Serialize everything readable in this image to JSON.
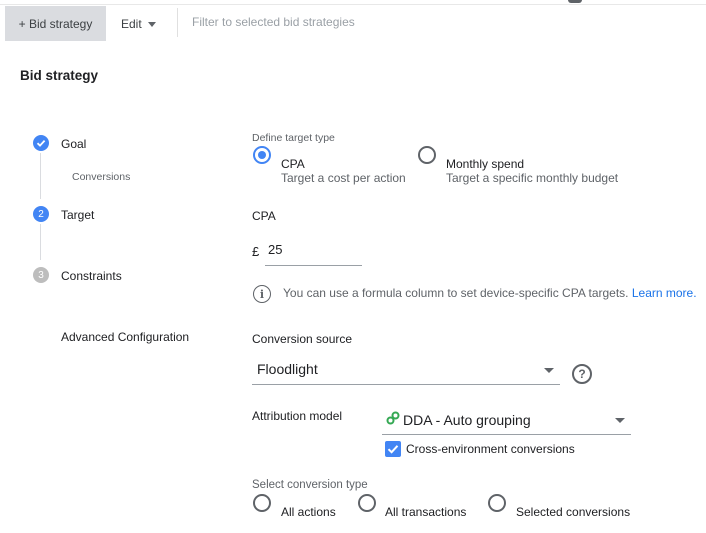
{
  "toolbar": {
    "add_bid_strategy": "+ Bid strategy",
    "edit": "Edit",
    "filter": "Filter to selected bid strategies"
  },
  "section_title": "Bid strategy",
  "steps": [
    {
      "label": "Goal",
      "state": "done",
      "sub": "Conversions"
    },
    {
      "label": "Target",
      "state": "active",
      "number": "2"
    },
    {
      "label": "Constraints",
      "state": "todo",
      "number": "3"
    },
    {
      "label": "Advanced Configuration"
    }
  ],
  "target_type": {
    "label": "Define target type",
    "options": [
      {
        "title": "CPA",
        "desc": "Target a cost per action",
        "selected": true
      },
      {
        "title": "Monthly spend",
        "desc": "Target a specific monthly budget",
        "selected": false
      }
    ]
  },
  "cpa": {
    "label": "CPA",
    "currency": "£",
    "value": "25"
  },
  "info": {
    "text": "You can use a formula column to set device-specific CPA targets. ",
    "link": "Learn more."
  },
  "conversion_source": {
    "label": "Conversion source",
    "value": "Floodlight"
  },
  "attribution": {
    "label": "Attribution model",
    "value": "DDA - Auto grouping",
    "cross_env_label": "Cross-environment conversions",
    "cross_env_checked": true
  },
  "conversion_type": {
    "label": "Select conversion type",
    "options": [
      "All actions",
      "All transactions",
      "Selected conversions"
    ]
  },
  "colors": {
    "accent": "#4285f4",
    "link": "#1a73e8",
    "dda_icon": "#34a853"
  }
}
